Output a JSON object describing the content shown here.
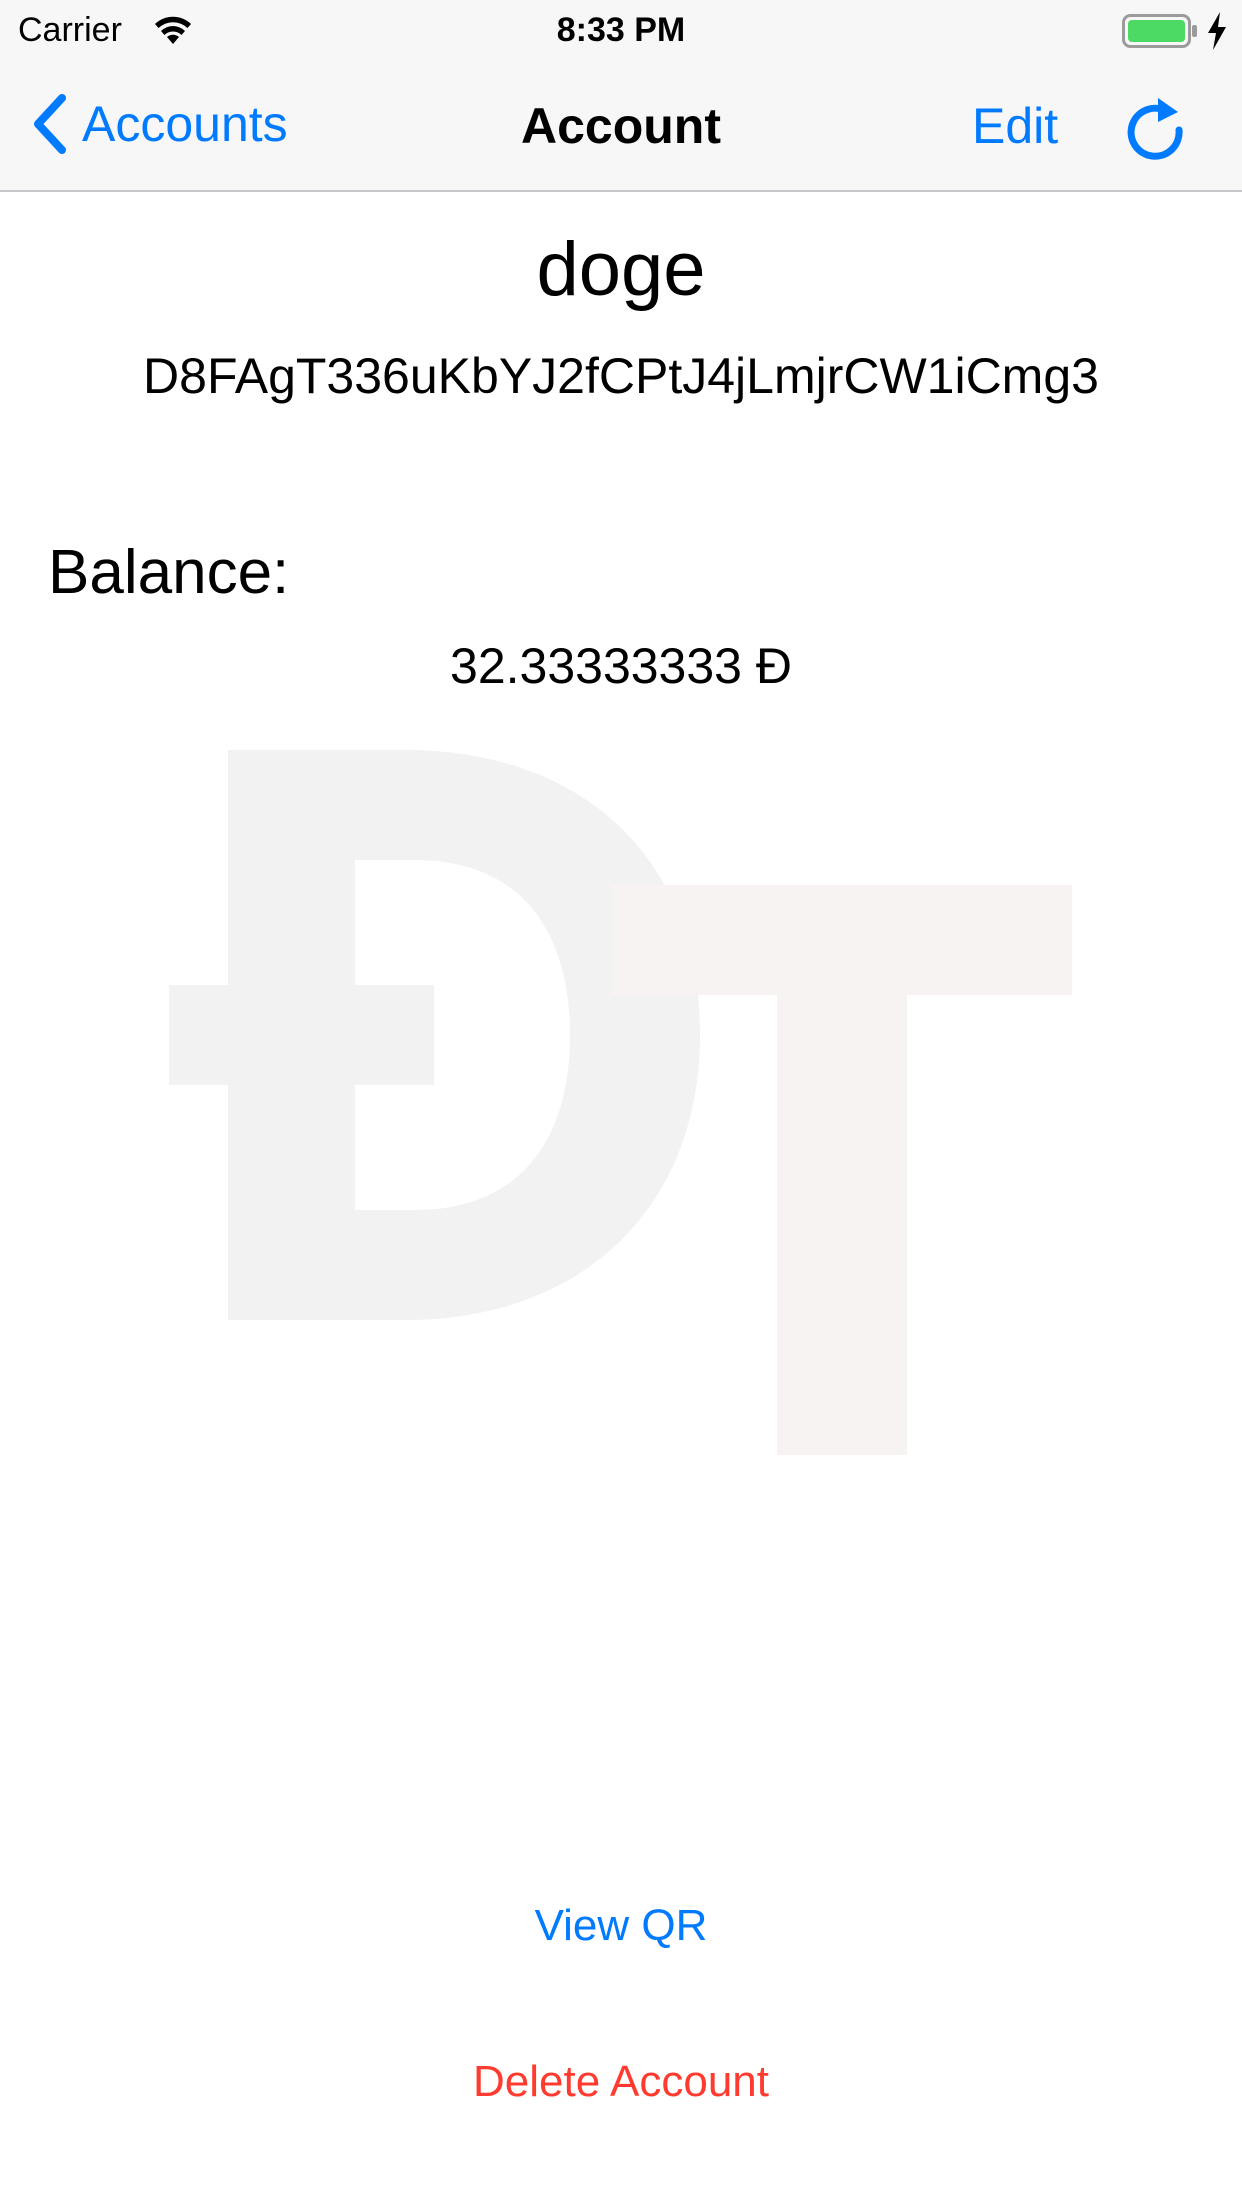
{
  "status_bar": {
    "carrier": "Carrier",
    "time": "8:33 PM",
    "wifi_icon": "wifi-icon",
    "battery_icon": "battery-charging-icon",
    "battery_color": "#4cd964"
  },
  "nav": {
    "back_label": "Accounts",
    "back_icon": "chevron-left-icon",
    "title": "Account",
    "edit_label": "Edit",
    "refresh_icon": "refresh-icon",
    "accent_color": "#007aff"
  },
  "account": {
    "name": "doge",
    "address": "D8FAgT336uKbYJ2fCPtJ4jLmjrCW1iCmg3",
    "balance_label": "Balance:",
    "balance_value": "32.33333333 Đ"
  },
  "watermark": {
    "icon": "dogecoin-logo-watermark",
    "text": "ĐT",
    "colors": [
      "#f2f2f2",
      "#f8f2f2"
    ]
  },
  "actions": {
    "view_qr_label": "View QR",
    "delete_label": "Delete Account",
    "delete_color": "#ff3b30"
  }
}
